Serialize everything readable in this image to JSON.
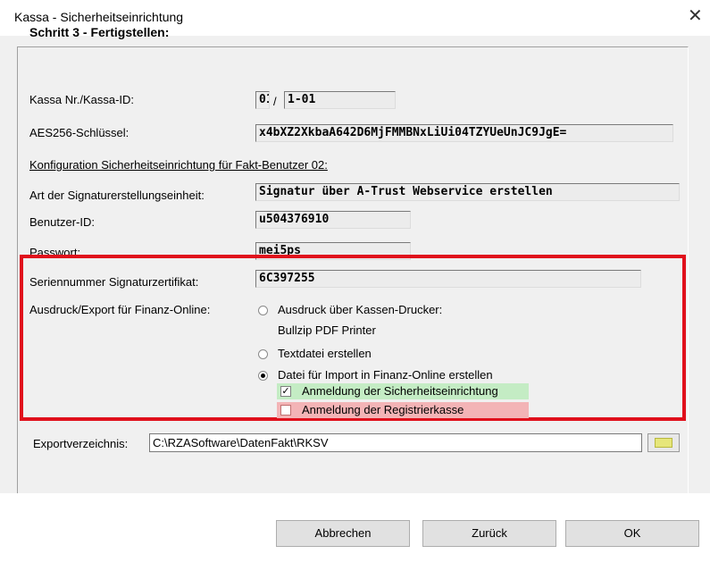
{
  "window": {
    "title": "Kassa - Sicherheitseinrichtung",
    "close_symbol": "✕"
  },
  "step": {
    "heading": "Schritt 3 - Fertigstellen:"
  },
  "kassa": {
    "label": "Kassa Nr./Kassa-ID:",
    "nr": "01",
    "separator": "/",
    "id": "1-01"
  },
  "aes": {
    "label": "AES256-Schlüssel:",
    "value": "x4bXZ2XkbaA642D6MjFMMBNxLiUi04TZYUeUnJC9JgE="
  },
  "config": {
    "heading": "Konfiguration Sicherheitseinrichtung für Fakt-Benutzer 02:",
    "art_label": "Art der Signaturerstellungseinheit:",
    "art_value": "Signatur über A-Trust Webservice erstellen",
    "user_label": "Benutzer-ID:",
    "user_value": "u504376910",
    "pass_label": "Passwort:",
    "pass_value": "mei5ps",
    "serial_label": "Seriennummer Signaturzertifikat:",
    "serial_value": "6C397255"
  },
  "export": {
    "label": "Ausdruck/Export für Finanz-Online:",
    "options": [
      {
        "label": "Ausdruck über Kassen-Drucker:",
        "sub": "Bullzip PDF Printer",
        "selected": false
      },
      {
        "label": "Textdatei erstellen",
        "selected": false
      },
      {
        "label": "Datei für Import in Finanz-Online erstellen",
        "selected": true
      }
    ],
    "checkboxes": [
      {
        "label": "Anmeldung der Sicherheitseinrichtung",
        "checked": true,
        "highlight": "#c4ecc4"
      },
      {
        "label": "Anmeldung der Registrierkasse",
        "checked": false,
        "highlight": "#f3b4b6"
      }
    ],
    "dir_label": "Exportverzeichnis:",
    "dir_value": "C:\\RZASoftware\\DatenFakt\\RKSV",
    "browse_icon": "folder-icon"
  },
  "buttons": {
    "cancel": "Abbrechen",
    "back": "Zurück",
    "ok": "OK"
  },
  "colors": {
    "highlight_border": "#e0101c",
    "checked_row": "#c4ecc4",
    "unchecked_row": "#f3b4b6"
  }
}
